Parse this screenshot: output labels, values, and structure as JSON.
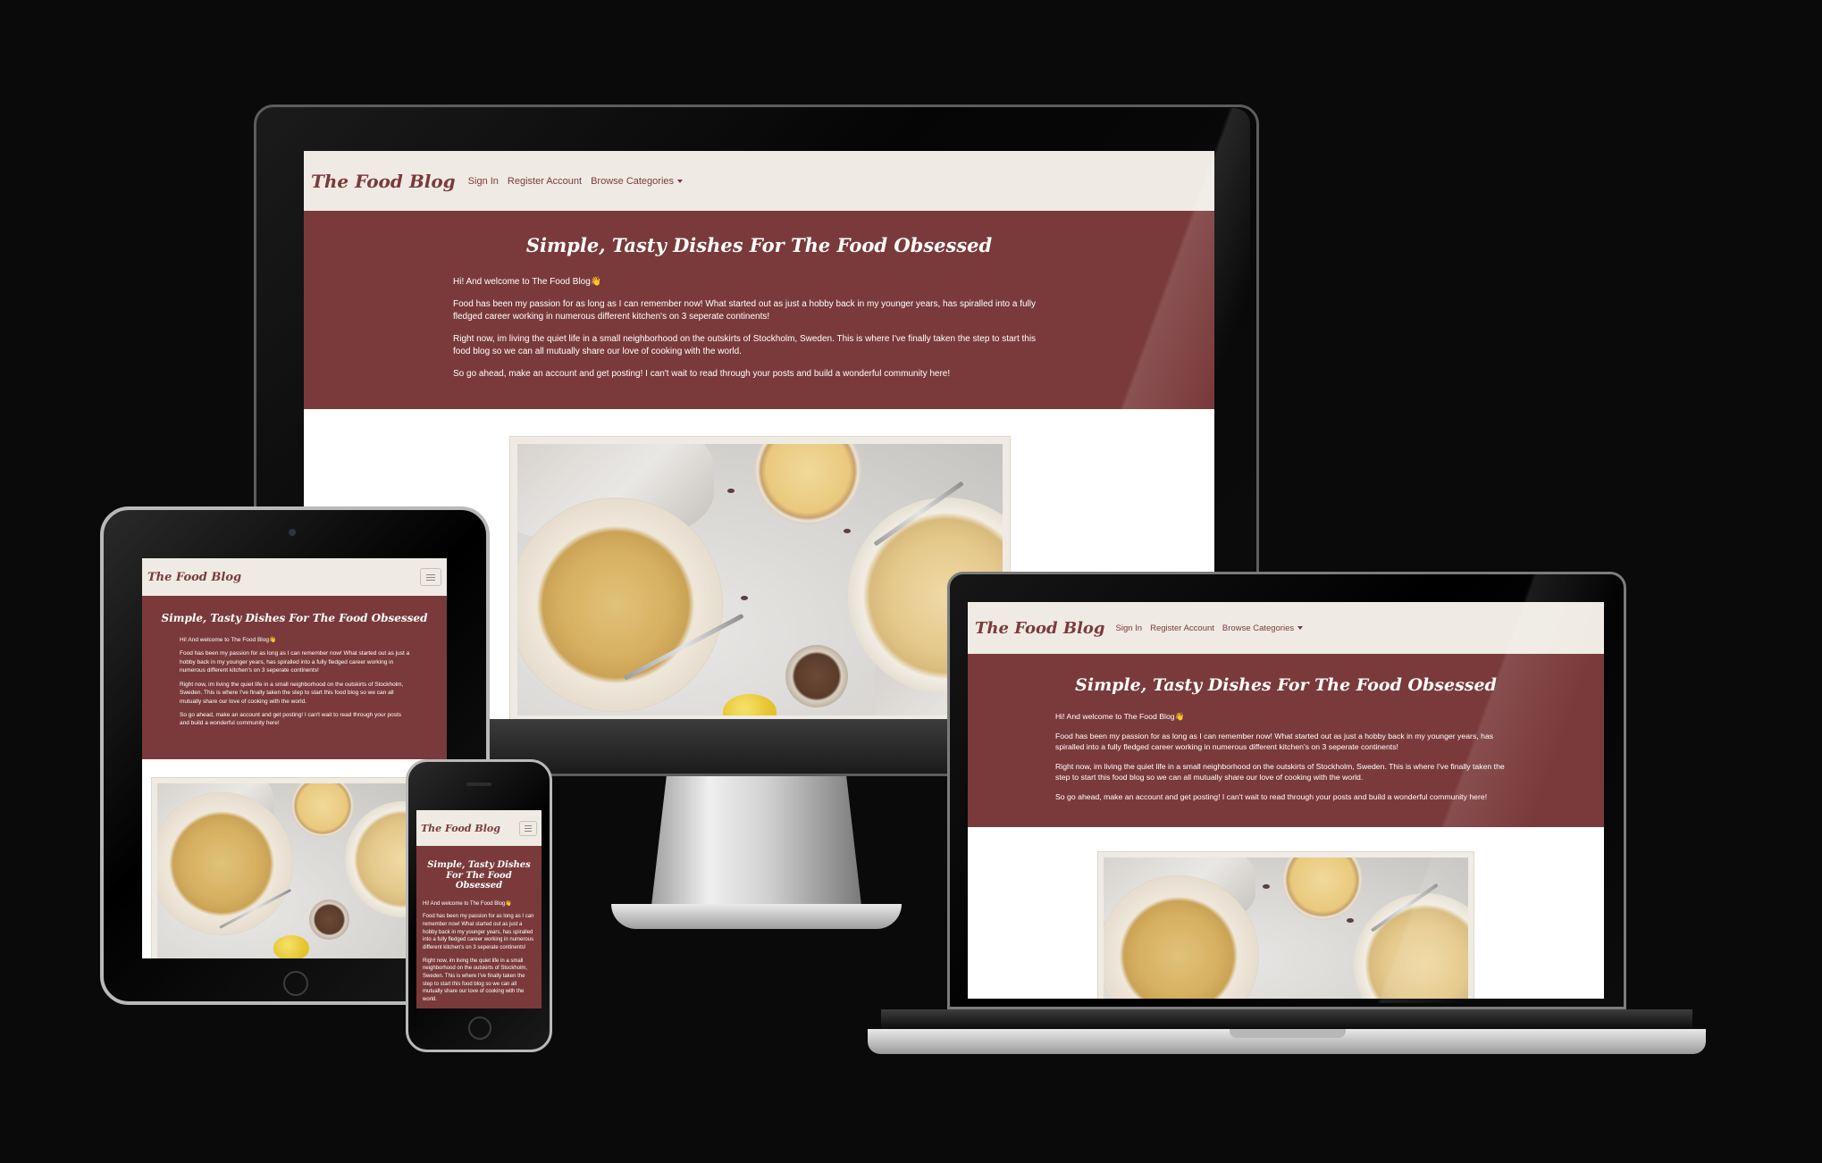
{
  "site": {
    "brand": "The Food Blog",
    "nav": {
      "sign_in": "Sign In",
      "register": "Register Account",
      "categories": "Browse Categories"
    },
    "hero": {
      "title": "Simple, Tasty Dishes For The Food Obsessed",
      "p1": "Hi! And welcome to The Food Blog👋",
      "p2": "Food has been my passion for as long as I can remember now! What started out as just a hobby back in my younger years, has spiralled into a fully fledged career working in numerous different kitchen's on 3 seperate continents!",
      "p3": "Right now, im living the quiet life in a small neighborhood on the outskirts of Stockholm, Sweden. This is where I've finally taken the step to start this food blog so we can all mutually share our love of cooking with the world.",
      "p4": "So go ahead, make an account and get posting! I can't wait to read through your posts and build a wonderful community here!"
    }
  },
  "colors": {
    "brand": "#7a3a3b",
    "nav_bg": "#efebe4",
    "hero_bg": "#7a3a3b",
    "background": "#0a0a0a"
  },
  "icons": {
    "menu": "hamburger-menu-icon",
    "dropdown": "caret-down-icon"
  }
}
